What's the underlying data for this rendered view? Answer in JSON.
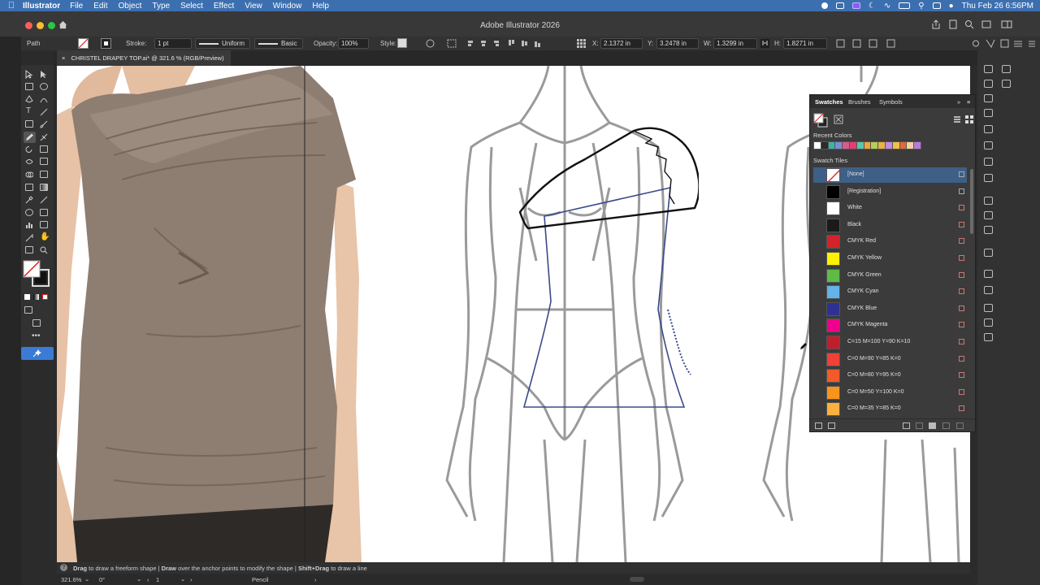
{
  "menubar": {
    "app_name": "Illustrator",
    "items": [
      "File",
      "Edit",
      "Object",
      "Type",
      "Select",
      "Effect",
      "View",
      "Window",
      "Help"
    ],
    "clock": "Thu Feb 26  6:56PM"
  },
  "window": {
    "title": "Adobe Illustrator 2026"
  },
  "control_bar": {
    "selection_label": "Path",
    "stroke_label": "Stroke:",
    "stroke_weight": "1 pt",
    "profile": "Uniform",
    "brush": "Basic",
    "opacity_label": "Opacity:",
    "opacity_value": "100%",
    "style_label": "Style:",
    "x_label": "X:",
    "x_value": "2.1372 in",
    "y_label": "Y:",
    "y_value": "3.2478 in",
    "w_label": "W:",
    "w_value": "1.3299 in",
    "h_label": "H:",
    "h_value": "1.8271 in"
  },
  "document": {
    "tab_title": "CHRISTEL DRAPEY TOP.ai* @ 321.6 % (RGB/Preview)"
  },
  "swatches_panel": {
    "tabs": [
      "Swatches",
      "Brushes",
      "Symbols"
    ],
    "recent_colors_label": "Recent Colors",
    "swatch_tiles_label": "Swatch Tiles",
    "swatches": [
      {
        "name": "[None]",
        "color": "none"
      },
      {
        "name": "[Registration]",
        "color": "#000000"
      },
      {
        "name": "White",
        "color": "#ffffff"
      },
      {
        "name": "Black",
        "color": "#1a1a1a"
      },
      {
        "name": "CMYK Red",
        "color": "#d2232a"
      },
      {
        "name": "CMYK Yellow",
        "color": "#fff200"
      },
      {
        "name": "CMYK Green",
        "color": "#5dbb46"
      },
      {
        "name": "CMYK Cyan",
        "color": "#63b3e8"
      },
      {
        "name": "CMYK Blue",
        "color": "#2e3192"
      },
      {
        "name": "CMYK Magenta",
        "color": "#ec008c"
      },
      {
        "name": "C=15 M=100 Y=90 K=10",
        "color": "#be1e2d"
      },
      {
        "name": "C=0 M=90 Y=85 K=0",
        "color": "#ef4136"
      },
      {
        "name": "C=0 M=80 Y=95 K=0",
        "color": "#f15a29"
      },
      {
        "name": "C=0 M=50 Y=100 K=0",
        "color": "#f7941d"
      },
      {
        "name": "C=0 M=35 Y=85 K=0",
        "color": "#fbb040"
      }
    ],
    "recent_colors": [
      "#ffffff",
      "#2b2b2b",
      "#39b5a8",
      "#7d8fd0",
      "#d65b8e",
      "#e43f6f",
      "#56c7b0",
      "#f2a33a",
      "#b0d15a",
      "#e8b24a",
      "#c48be0",
      "#f0c04a",
      "#e06a3b",
      "#f1d4a1",
      "#ba7bd8"
    ]
  },
  "hint_bar": {
    "part1_bold": "Drag",
    "part1": " to draw a freeform shape | ",
    "part2_bold": "Draw",
    "part2": " over the anchor points to modify the shape | ",
    "part3_bold": "Shift+Drag",
    "part3": " to draw a line"
  },
  "status_bar": {
    "zoom": "321.6%",
    "rotation": "0°",
    "artboard": "1",
    "tool": "Pencil"
  },
  "colors": {
    "menubar": "#3c6fb0",
    "panel": "#3b3b3b",
    "selected_swatch": "#3e5f86",
    "path_blue": "#3a4a8a"
  }
}
